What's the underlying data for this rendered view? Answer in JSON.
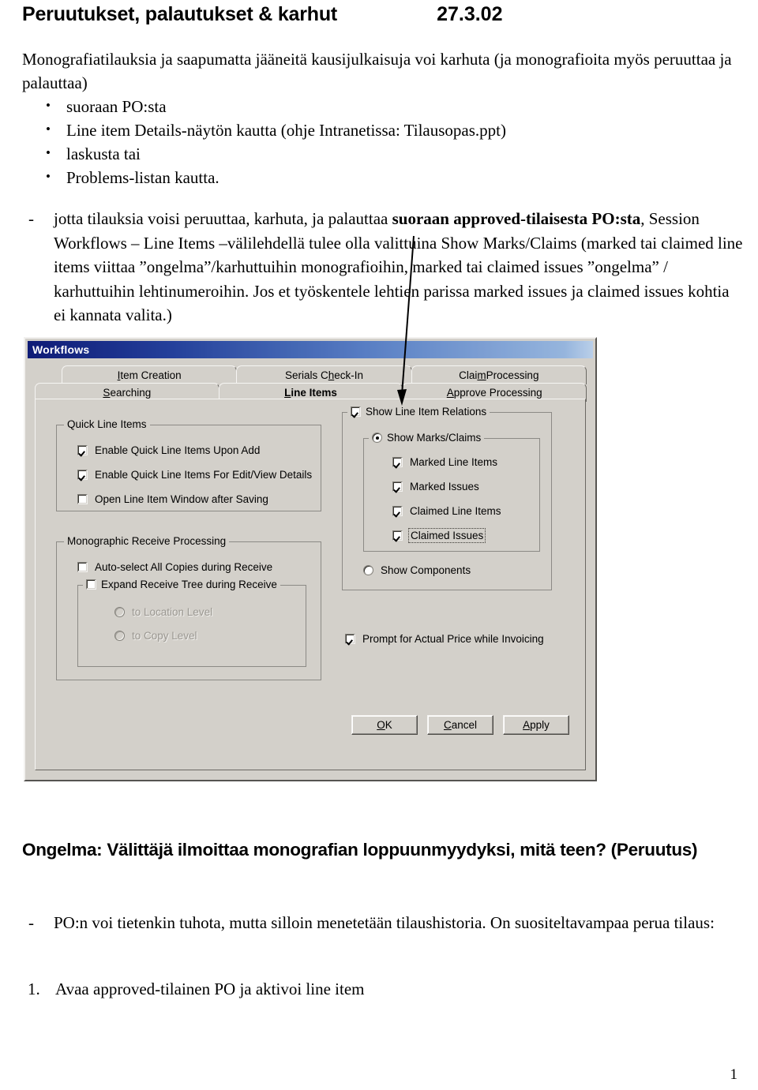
{
  "document": {
    "title": "Peruutukset, palautukset & karhut",
    "date": "27.3.02",
    "page_number": "1",
    "intro_paragraph": "Monografiatilauksia ja saapumatta jääneitä kausijulkaisuja voi karhuta (ja monografioita myös peruuttaa ja palauttaa)",
    "bullets": [
      "suoraan PO:sta",
      "Line item Details-näytön kautta (ohje Intranetissa: Tilausopas.ppt)",
      "laskusta tai",
      "Problems-listan kautta."
    ],
    "dash_item_1": {
      "marker": "-",
      "text_before_bold": "jotta tilauksia voisi peruuttaa, karhuta, ja palauttaa ",
      "bold_text": "suoraan approved-tilaisesta PO:sta",
      "text_after_bold": ", Session Workflows – Line Items –välilehdellä tulee olla valittuina Show Marks/Claims (marked tai claimed line items viittaa ”ongelma”/karhuttuihin monografioihin, marked tai claimed issues ”ongelma” / karhuttuihin lehtinumeroihin. Jos et työskentele lehtien parissa marked issues ja claimed issues kohtia ei kannata valita.)"
    },
    "section_heading": "Ongelma: Välittäjä ilmoittaa monografian loppuunmyydyksi, mitä teen? (Peruutus)",
    "dash_item_2": {
      "marker": "-",
      "text": "PO:n voi tietenkin tuhota, mutta silloin menetetään tilaushistoria. On suositeltavampaa perua tilaus:"
    },
    "numbered_item_1": {
      "marker": "1.",
      "text": "Avaa approved-tilainen PO ja aktivoi line item"
    }
  },
  "dialog": {
    "title": "Workflows",
    "tabs_top": [
      {
        "label_pre": "",
        "label_mnemonic": "I",
        "label_post": "tem Creation",
        "active": false
      },
      {
        "label_pre": "Serials C",
        "label_mnemonic": "h",
        "label_post": "eck-In",
        "active": false
      },
      {
        "label_pre": "Clai",
        "label_mnemonic": "m",
        "label_post": " Processing",
        "active": false
      }
    ],
    "tabs_bottom": [
      {
        "label_pre": "",
        "label_mnemonic": "S",
        "label_post": "earching",
        "active": false
      },
      {
        "label_pre": "",
        "label_mnemonic": "L",
        "label_post": "ine Items",
        "active": true
      },
      {
        "label_pre": "",
        "label_mnemonic": "A",
        "label_post": "pprove Processing",
        "active": false
      }
    ],
    "group_quick_line_items": {
      "title": "Quick Line Items",
      "options": [
        {
          "label": "Enable Quick Line Items Upon Add",
          "checked": true
        },
        {
          "label": "Enable Quick Line Items For Edit/View Details",
          "checked": true
        },
        {
          "label": "Open Line Item Window after Saving",
          "checked": false
        }
      ]
    },
    "group_monographic_receive": {
      "title": "Monographic Receive Processing",
      "auto_select": {
        "label": "Auto-select All Copies during Receive",
        "checked": false
      },
      "expand_tree": {
        "label": "Expand Receive Tree during Receive",
        "checked": false
      },
      "levels": [
        {
          "label": "to Location Level",
          "selected": false,
          "disabled": true
        },
        {
          "label": "to Copy Level",
          "selected": false,
          "disabled": true
        }
      ]
    },
    "group_show_relations": {
      "title": "Show Line Item Relations",
      "checked": true,
      "marks_claims": {
        "title": "Show Marks/Claims",
        "selected": true,
        "options": [
          {
            "label": "Marked Line Items",
            "checked": true,
            "focused": false
          },
          {
            "label": "Marked Issues",
            "checked": true,
            "focused": false
          },
          {
            "label": "Claimed Line Items",
            "checked": true,
            "focused": false
          },
          {
            "label": "Claimed Issues",
            "checked": true,
            "focused": true
          }
        ]
      },
      "show_components": {
        "label": "Show Components",
        "selected": false
      }
    },
    "prompt_actual_price": {
      "label": "Prompt for Actual Price while Invoicing",
      "checked": true
    },
    "buttons": [
      {
        "label_pre": "",
        "label_mnemonic": "O",
        "label_post": "K"
      },
      {
        "label_pre": "",
        "label_mnemonic": "C",
        "label_post": "ancel"
      },
      {
        "label_pre": "",
        "label_mnemonic": "A",
        "label_post": "pply"
      }
    ]
  },
  "annotation": {
    "arrow_color": "#000000"
  }
}
